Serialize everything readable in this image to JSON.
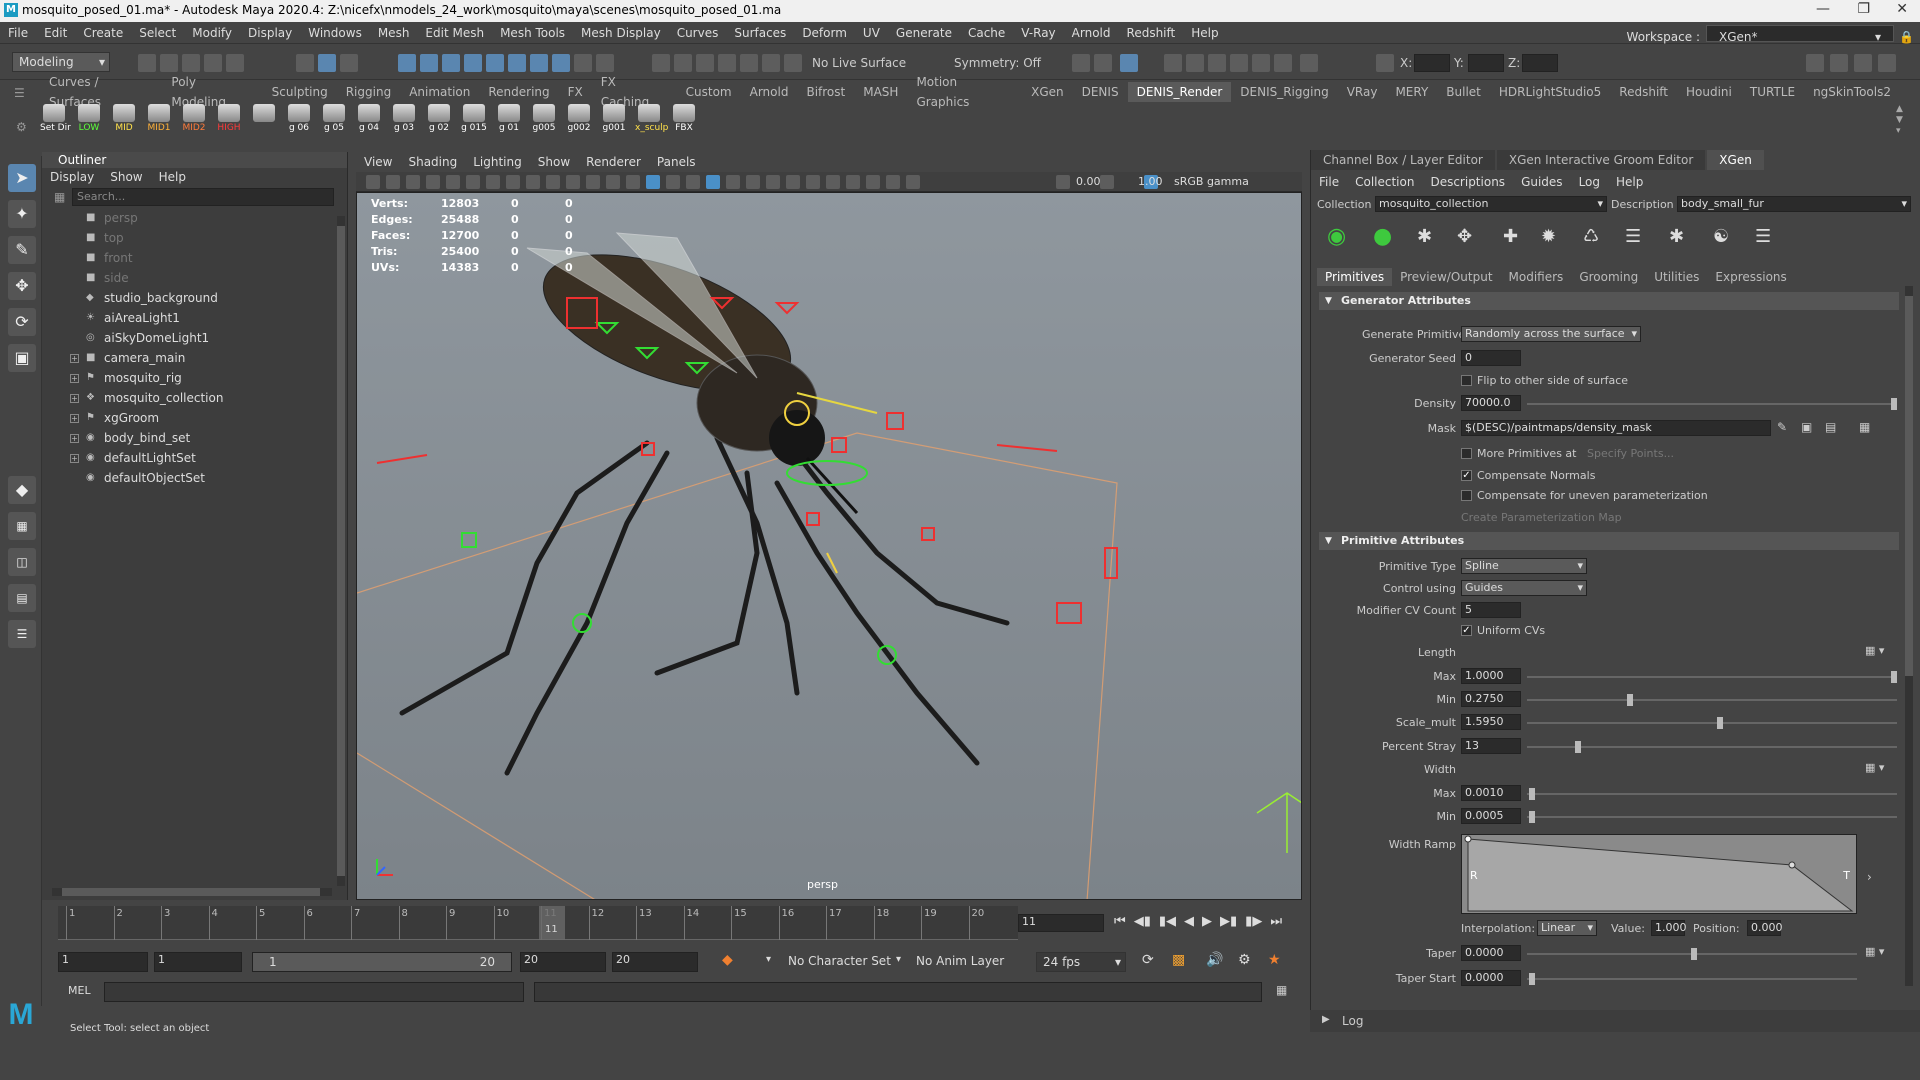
{
  "window": {
    "title": "mosquito_posed_01.ma* - Autodesk Maya 2020.4: Z:\\nicefx\\nmodels_24_work\\mosquito\\maya\\scenes\\mosquito_posed_01.ma"
  },
  "menubar": [
    "File",
    "Edit",
    "Create",
    "Select",
    "Modify",
    "Display",
    "Windows",
    "Mesh",
    "Edit Mesh",
    "Mesh Tools",
    "Mesh Display",
    "Curves",
    "Surfaces",
    "Deform",
    "UV",
    "Generate",
    "Cache",
    "V-Ray",
    "Arnold",
    "Redshift",
    "Help"
  ],
  "workspace": {
    "label": "Workspace :",
    "value": "XGen*"
  },
  "statusline": {
    "mode": "Modeling",
    "live_surface": "No Live Surface",
    "symmetry": "Symmetry: Off",
    "x_label": "X:",
    "y_label": "Y:",
    "z_label": "Z:"
  },
  "shelf_tabs": [
    "Curves / Surfaces",
    "Poly Modeling",
    "Sculpting",
    "Rigging",
    "Animation",
    "Rendering",
    "FX",
    "FX Caching",
    "Custom",
    "Arnold",
    "Bifrost",
    "MASH",
    "Motion Graphics",
    "XGen",
    "DENIS",
    "DENIS_Render",
    "DENIS_Rigging",
    "VRay",
    "MERY",
    "Bullet",
    "HDRLightStudio5",
    "Redshift",
    "Houdini",
    "TURTLE",
    "ngSkinTools2"
  ],
  "shelf_active": "DENIS_Render",
  "shelf_icons": [
    {
      "label": "Set Dir",
      "color": "#ffffff"
    },
    {
      "label": "LOW",
      "color": "#5cff3a"
    },
    {
      "label": "MID",
      "color": "#ffe14a"
    },
    {
      "label": "MID1",
      "color": "#ffb13a"
    },
    {
      "label": "MID2",
      "color": "#ff7a3a"
    },
    {
      "label": "HIGH",
      "color": "#ff3a3a"
    },
    {
      "label": "",
      "color": "#ffffff"
    },
    {
      "label": "g 06",
      "color": "#ffffff"
    },
    {
      "label": "g 05",
      "color": "#ffffff"
    },
    {
      "label": "g 04",
      "color": "#ffffff"
    },
    {
      "label": "g 03",
      "color": "#ffffff"
    },
    {
      "label": "g 02",
      "color": "#ffffff"
    },
    {
      "label": "g 015",
      "color": "#ffffff"
    },
    {
      "label": "g 01",
      "color": "#ffffff"
    },
    {
      "label": "g005",
      "color": "#ffffff"
    },
    {
      "label": "g002",
      "color": "#ffffff"
    },
    {
      "label": "g001",
      "color": "#ffffff"
    },
    {
      "label": "x_sculp",
      "color": "#ffe14a"
    },
    {
      "label": "FBX",
      "color": "#ffffff"
    }
  ],
  "outliner": {
    "title": "Outliner",
    "menu": [
      "Display",
      "Show",
      "Help"
    ],
    "search_placeholder": "Search...",
    "items": [
      {
        "name": "persp",
        "icon": "camera-icon",
        "dim": true,
        "expandable": false
      },
      {
        "name": "top",
        "icon": "camera-icon",
        "dim": true,
        "expandable": false
      },
      {
        "name": "front",
        "icon": "camera-icon",
        "dim": true,
        "expandable": false
      },
      {
        "name": "side",
        "icon": "camera-icon",
        "dim": true,
        "expandable": false
      },
      {
        "name": "studio_background",
        "icon": "mesh-icon",
        "dim": false,
        "expandable": false
      },
      {
        "name": "aiAreaLight1",
        "icon": "light-icon",
        "dim": false,
        "expandable": false
      },
      {
        "name": "aiSkyDomeLight1",
        "icon": "skydome-icon",
        "dim": false,
        "expandable": false
      },
      {
        "name": "camera_main",
        "icon": "camera-icon",
        "dim": false,
        "expandable": true
      },
      {
        "name": "mosquito_rig",
        "icon": "rig-icon",
        "dim": false,
        "expandable": true
      },
      {
        "name": "mosquito_collection",
        "icon": "collection-icon",
        "dim": false,
        "expandable": true
      },
      {
        "name": "xgGroom",
        "icon": "rig-icon",
        "dim": false,
        "expandable": true
      },
      {
        "name": "body_bind_set",
        "icon": "set-icon",
        "dim": false,
        "expandable": true
      },
      {
        "name": "defaultLightSet",
        "icon": "set-icon",
        "dim": false,
        "expandable": true
      },
      {
        "name": "defaultObjectSet",
        "icon": "set-icon",
        "dim": false,
        "expandable": false
      }
    ]
  },
  "viewport": {
    "menu": [
      "View",
      "Shading",
      "Lighting",
      "Show",
      "Renderer",
      "Panels"
    ],
    "exposure": "0.00",
    "gamma": "1.00",
    "colorspace": "sRGB gamma",
    "camera": "persp",
    "hud": [
      {
        "label": "Verts:",
        "a": "12803",
        "b": "0",
        "c": "0"
      },
      {
        "label": "Edges:",
        "a": "25488",
        "b": "0",
        "c": "0"
      },
      {
        "label": "Faces:",
        "a": "12700",
        "b": "0",
        "c": "0"
      },
      {
        "label": "Tris:",
        "a": "25400",
        "b": "0",
        "c": "0"
      },
      {
        "label": "UVs:",
        "a": "14383",
        "b": "0",
        "c": "0"
      }
    ]
  },
  "right_panel": {
    "tabs": [
      "Channel Box / Layer Editor",
      "XGen Interactive Groom Editor",
      "XGen"
    ],
    "active_tab": "XGen",
    "menu": [
      "File",
      "Collection",
      "Descriptions",
      "Guides",
      "Log",
      "Help"
    ],
    "collection_label": "Collection",
    "collection_value": "mosquito_collection",
    "description_label": "Description",
    "description_value": "body_small_fur",
    "subtabs": [
      "Primitives",
      "Preview/Output",
      "Modifiers",
      "Grooming",
      "Utilities",
      "Expressions"
    ],
    "active_subtab": "Primitives",
    "generator": {
      "section": "Generator Attributes",
      "generate_primitives_label": "Generate Primitives",
      "generate_primitives_value": "Randomly across the surface",
      "seed_label": "Generator Seed",
      "seed_value": "0",
      "flip_label": "Flip to other side of surface",
      "density_label": "Density",
      "density_value": "70000.0",
      "mask_label": "Mask",
      "mask_value": "$(DESC)/paintmaps/density_mask",
      "more_primitives_label": "More Primitives at",
      "specify_points_label": "Specify Points...",
      "compensate_normals_label": "Compensate Normals",
      "compensate_uneven_label": "Compensate for uneven parameterization",
      "create_param_map_label": "Create Parameterization Map"
    },
    "primitive": {
      "section": "Primitive Attributes",
      "type_label": "Primitive Type",
      "type_value": "Spline",
      "control_label": "Control using",
      "control_value": "Guides",
      "cv_count_label": "Modifier CV Count",
      "cv_count_value": "5",
      "uniform_cvs_label": "Uniform CVs",
      "length_label": "Length",
      "length_max_label": "Max",
      "length_max_value": "1.0000",
      "length_min_label": "Min",
      "length_min_value": "0.2750",
      "scale_mult_label": "Scale_mult",
      "scale_mult_value": "1.5950",
      "percent_stray_label": "Percent Stray",
      "percent_stray_value": "13",
      "width_label": "Width",
      "width_max_label": "Max",
      "width_max_value": "0.0010",
      "width_min_label": "Min",
      "width_min_value": "0.0005",
      "width_ramp_label": "Width Ramp",
      "ramp_r": "R",
      "ramp_t": "T",
      "interp_label": "Interpolation:",
      "interp_value": "Linear",
      "value_label": "Value:",
      "value_value": "1.000",
      "position_label": "Position:",
      "position_value": "0.000",
      "taper_label": "Taper",
      "taper_value": "0.0000",
      "taper_start_label": "Taper Start",
      "taper_start_value": "0.0000"
    },
    "log_label": "Log"
  },
  "timeline": {
    "ticks": [
      "1",
      "2",
      "3",
      "4",
      "5",
      "6",
      "7",
      "8",
      "9",
      "10",
      "11",
      "12",
      "13",
      "14",
      "15",
      "16",
      "17",
      "18",
      "19",
      "20"
    ],
    "current_frame": "11",
    "current_frame_field": "11"
  },
  "range": {
    "start": "1",
    "anim_start": "1",
    "range_start": "1",
    "range_end": "20",
    "anim_end": "20",
    "end": "20",
    "character_set": "No Character Set",
    "anim_layer": "No Anim Layer",
    "fps": "24 fps"
  },
  "command": {
    "label": "MEL"
  },
  "helpline": {
    "text": "Select Tool: select an object"
  }
}
